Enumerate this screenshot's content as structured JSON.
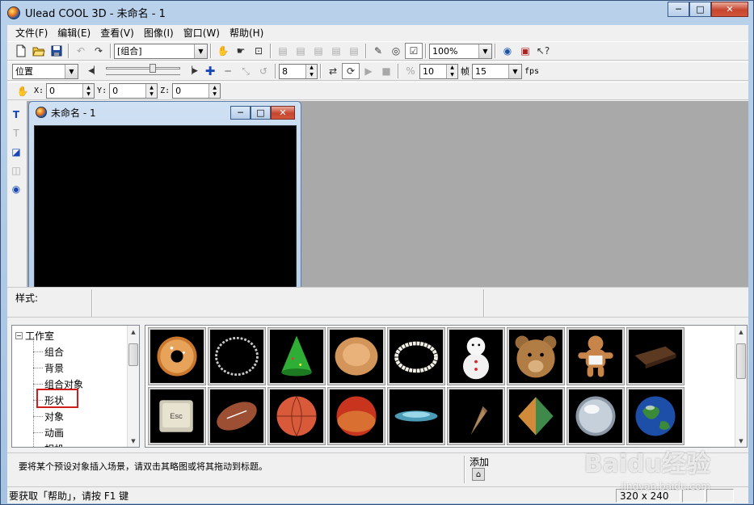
{
  "window": {
    "title": "Ulead COOL 3D - 未命名 - 1",
    "min_glyph": "─",
    "max_glyph": "□",
    "close_glyph": "✕"
  },
  "menu": [
    "文件(F)",
    "编辑(E)",
    "查看(V)",
    "图像(I)",
    "窗口(W)",
    "帮助(H)"
  ],
  "toolbar1": {
    "object_combo": "[组合]",
    "zoom_combo": "100%"
  },
  "toolbar2": {
    "attribute_combo": "位置",
    "frame_value": "8",
    "speed_value": "10",
    "frame_label": "帧",
    "fps_value": "15",
    "fps_label": "fps"
  },
  "toolbar3": {
    "x_label": "X:",
    "x_value": "0",
    "y_label": "Y:",
    "y_value": "0",
    "z_label": "Z:",
    "z_value": "0"
  },
  "document": {
    "title": "未命名 - 1"
  },
  "style_bar": {
    "label": "样式:"
  },
  "tree": {
    "root": "工作室",
    "expander": "−",
    "items": [
      "组合",
      "背景",
      "组合对象",
      "形状",
      "对象",
      "动画",
      "相机"
    ],
    "highlighted": "形状"
  },
  "thumbnails": [
    "donut",
    "ring",
    "cone-green",
    "bun",
    "pearl-necklace",
    "snowman",
    "bear-head",
    "gingerbread-man",
    "chocolate-bar",
    "esc-key",
    "rugby-ball",
    "basketball",
    "red-ball",
    "spinning-top",
    "pine-cone",
    "pyramid-face",
    "chrome-sphere",
    "earth-globe"
  ],
  "info_bar": {
    "hint": "要将某个预设对象插入场景，请双击其略图或将其拖动到标题。",
    "add_label": "添加"
  },
  "status_bar": {
    "text": "要获取「帮助」，请按 F1 键",
    "size": "320 x 240"
  },
  "watermark": {
    "brand": "Baidu经验",
    "url": "jingyan.baidu.com"
  }
}
